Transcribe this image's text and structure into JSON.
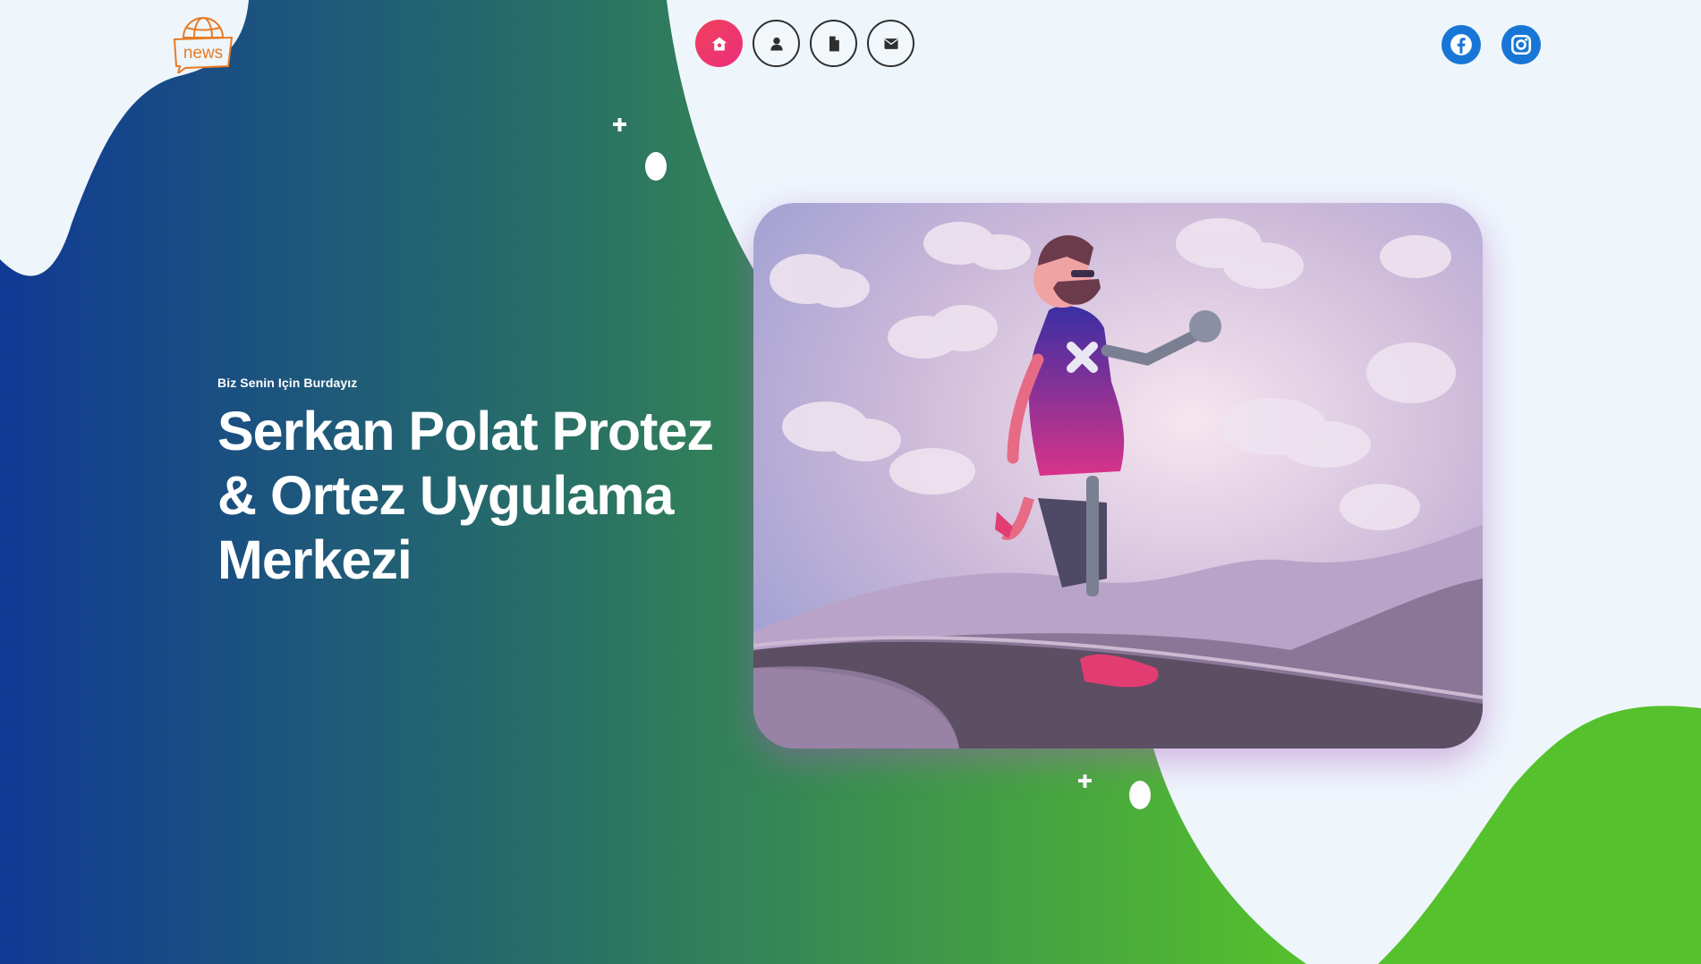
{
  "logo": {
    "text": "news",
    "color": "#e87b24"
  },
  "nav": {
    "items": [
      {
        "name": "home",
        "icon": "home-icon",
        "active": true
      },
      {
        "name": "about",
        "icon": "user-icon",
        "active": false
      },
      {
        "name": "documents",
        "icon": "file-icon",
        "active": false
      },
      {
        "name": "contact",
        "icon": "envelope-icon",
        "active": false
      }
    ]
  },
  "social": {
    "items": [
      {
        "name": "facebook",
        "icon": "facebook-icon"
      },
      {
        "name": "instagram",
        "icon": "instagram-icon"
      }
    ],
    "color": "#1877d6"
  },
  "hero": {
    "subtitle": "Biz Senin Için Burdayız",
    "title_lines": [
      "Serkan Polat Protez",
      "& Ortez Uygulama",
      "Merkezi"
    ]
  },
  "colors": {
    "gradient_start": "#103a94",
    "gradient_mid": "#2a7264",
    "gradient_end": "#55c12c",
    "accent": "#ee3a66",
    "background": "#eef6fc"
  }
}
